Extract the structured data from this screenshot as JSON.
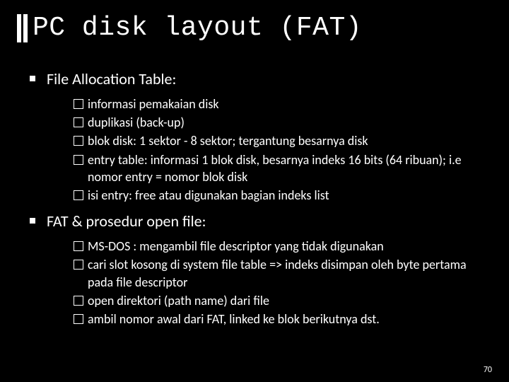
{
  "title": "PC disk layout (FAT)",
  "sections": [
    {
      "heading": "File Allocation Table:",
      "items": [
        "informasi pemakaian disk",
        "duplikasi (back-up)",
        "blok disk: 1 sektor  - 8 sektor; tergantung besarnya disk",
        "entry table: informasi 1 blok disk, besarnya indeks 16 bits (64 ribuan); i.e nomor entry = nomor blok disk",
        "isi entry: free atau digunakan bagian indeks list"
      ]
    },
    {
      "heading": "FAT & prosedur open file:",
      "items": [
        "MS-DOS : mengambil file descriptor yang tidak digunakan",
        "cari slot kosong di system file table => indeks disimpan oleh byte pertama pada file descriptor",
        "open direktori (path name) dari file",
        "ambil nomor awal dari FAT, linked ke blok berikutnya dst."
      ]
    }
  ],
  "page_number": "70"
}
